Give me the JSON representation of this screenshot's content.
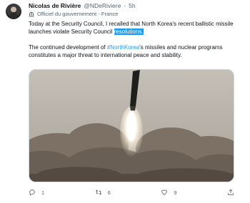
{
  "tweet": {
    "author_name": "Nicolas de Rivière",
    "handle": "@NDeRiviere",
    "separator": "·",
    "time": "5h",
    "affiliation": "Officiel du gouvernement - France",
    "para1_before": "Today at the Security Council, I recalled that North Korea's recent ballistic missile launches violate Security Council ",
    "para1_highlight": "resolutions.",
    "para2_before": "The continued development of ",
    "para2_hashtag": "#NorthKorea",
    "para2_after": "'s missiles and nuclear programs constitutes a major threat to international peace and stability."
  },
  "actions": {
    "reply_count": "1",
    "retweet_count": "6",
    "like_count": "9"
  },
  "icons": {
    "avatar": "avatar",
    "affiliation": "government-building-icon",
    "reply": "reply-icon",
    "retweet": "retweet-icon",
    "like": "heart-icon",
    "share": "share-icon"
  },
  "colors": {
    "accent": "#1d9bf0",
    "secondary_text": "#536471",
    "text": "#0f1419"
  }
}
